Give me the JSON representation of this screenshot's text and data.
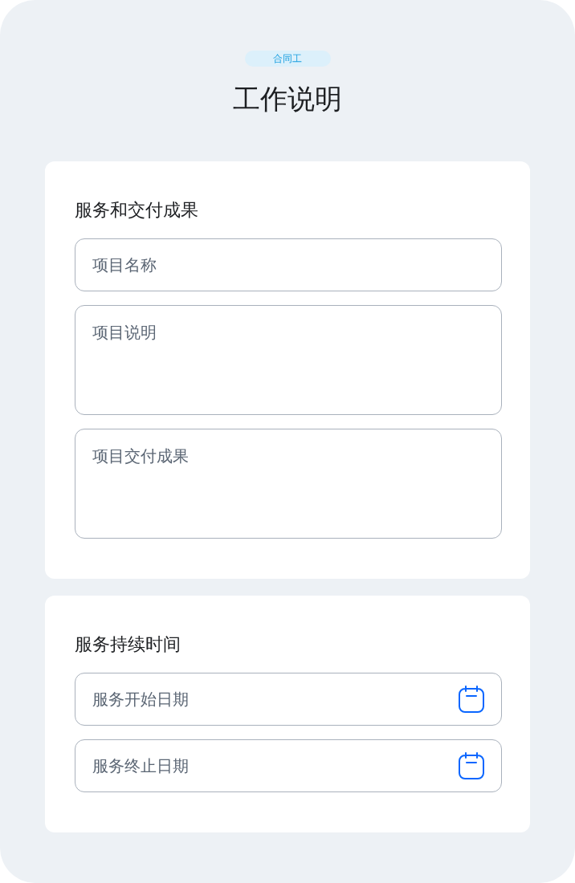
{
  "header": {
    "badge": "合同工",
    "title": "工作说明"
  },
  "sections": [
    {
      "heading": "服务和交付成果",
      "fields": [
        {
          "kind": "text",
          "placeholder": "项目名称"
        },
        {
          "kind": "textarea",
          "placeholder": "项目说明"
        },
        {
          "kind": "textarea",
          "placeholder": "项目交付成果"
        }
      ]
    },
    {
      "heading": "服务持续时间",
      "fields": [
        {
          "kind": "date",
          "placeholder": "服务开始日期"
        },
        {
          "kind": "date",
          "placeholder": "服务终止日期"
        }
      ]
    }
  ]
}
